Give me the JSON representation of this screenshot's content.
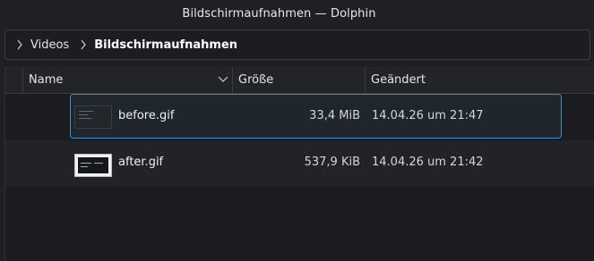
{
  "window": {
    "title": "Bildschirmaufnahmen — Dolphin"
  },
  "breadcrumb": {
    "items": [
      "Videos",
      "Bildschirmaufnahmen"
    ]
  },
  "columns": {
    "name": "Name",
    "size": "Größe",
    "modified": "Geändert"
  },
  "files": [
    {
      "name": "before.gif",
      "size": "33,4 MiB",
      "modified": "14.04.26 um 21:47",
      "selected": true
    },
    {
      "name": "after.gif",
      "size": "537,9 KiB",
      "modified": "14.04.26 um 21:42",
      "selected": false
    }
  ],
  "icons": {
    "breadcrumb_separator": "chevron-right-icon",
    "sort_indicator": "chevron-down-icon"
  },
  "colors": {
    "selection_border": "#3d8fc4",
    "background": "#1b1c1f"
  }
}
